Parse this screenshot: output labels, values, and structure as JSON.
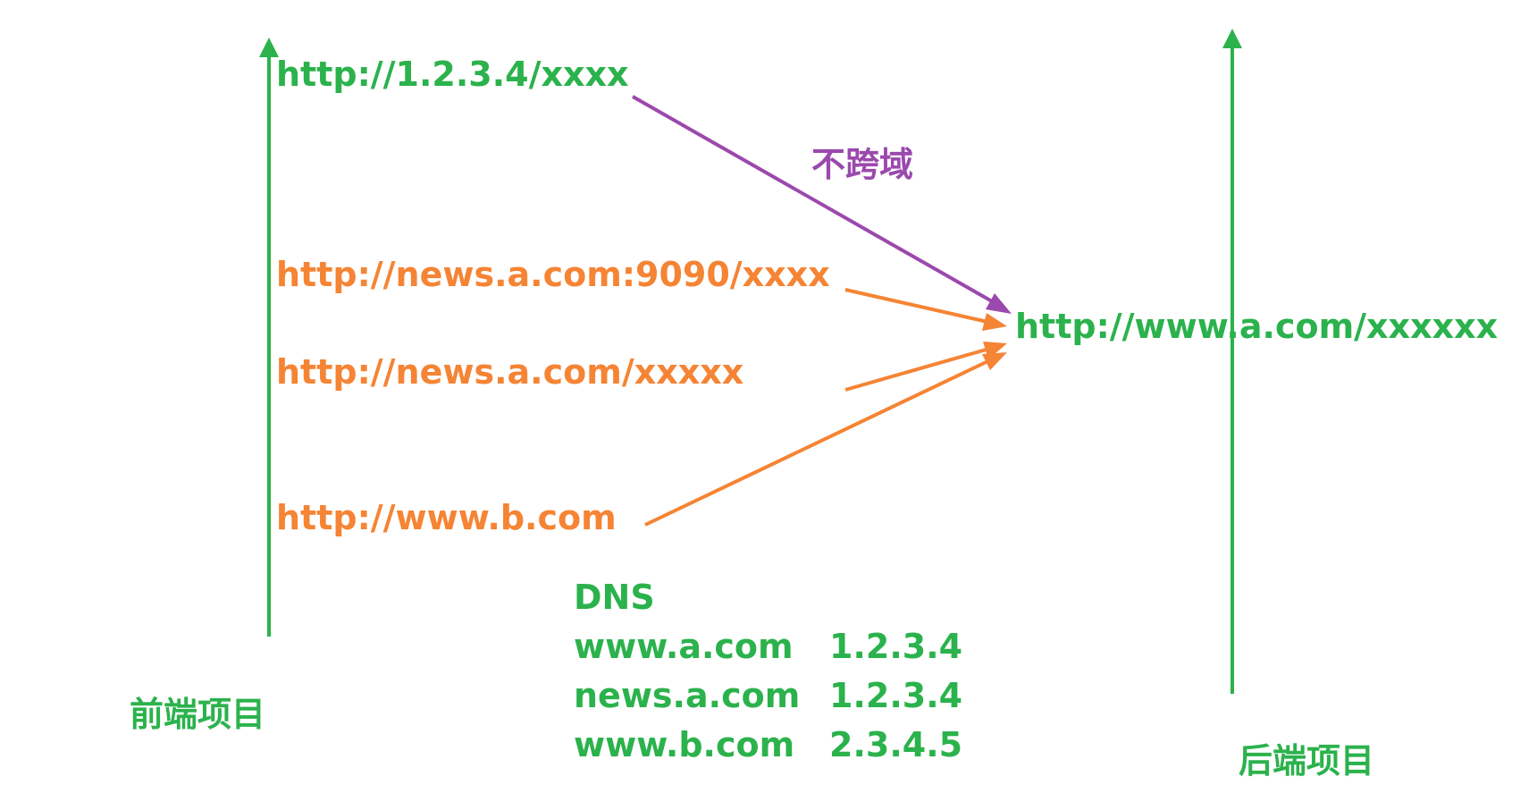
{
  "colors": {
    "green": "#2bb24c",
    "orange": "#f58434",
    "purple": "#9b49ad",
    "background": "#ffffff"
  },
  "frontend": {
    "label": "前端项目",
    "urls": [
      {
        "text": "http://1.2.3.4/xxxx",
        "color": "green"
      },
      {
        "text": "http://news.a.com:9090/xxxx",
        "color": "orange"
      },
      {
        "text": "http://news.a.com/xxxxx",
        "color": "orange"
      },
      {
        "text": "http://www.b.com",
        "color": "orange"
      }
    ]
  },
  "backend": {
    "label": "后端项目",
    "url": "http://www.a.com/xxxxxx"
  },
  "annotation": {
    "label": "不跨域"
  },
  "dns": {
    "title": "DNS",
    "entries": [
      {
        "host": "www.a.com",
        "ip": "1.2.3.4"
      },
      {
        "host": "news.a.com",
        "ip": "1.2.3.4"
      },
      {
        "host": "www.b.com",
        "ip": "2.3.4.5"
      }
    ]
  }
}
